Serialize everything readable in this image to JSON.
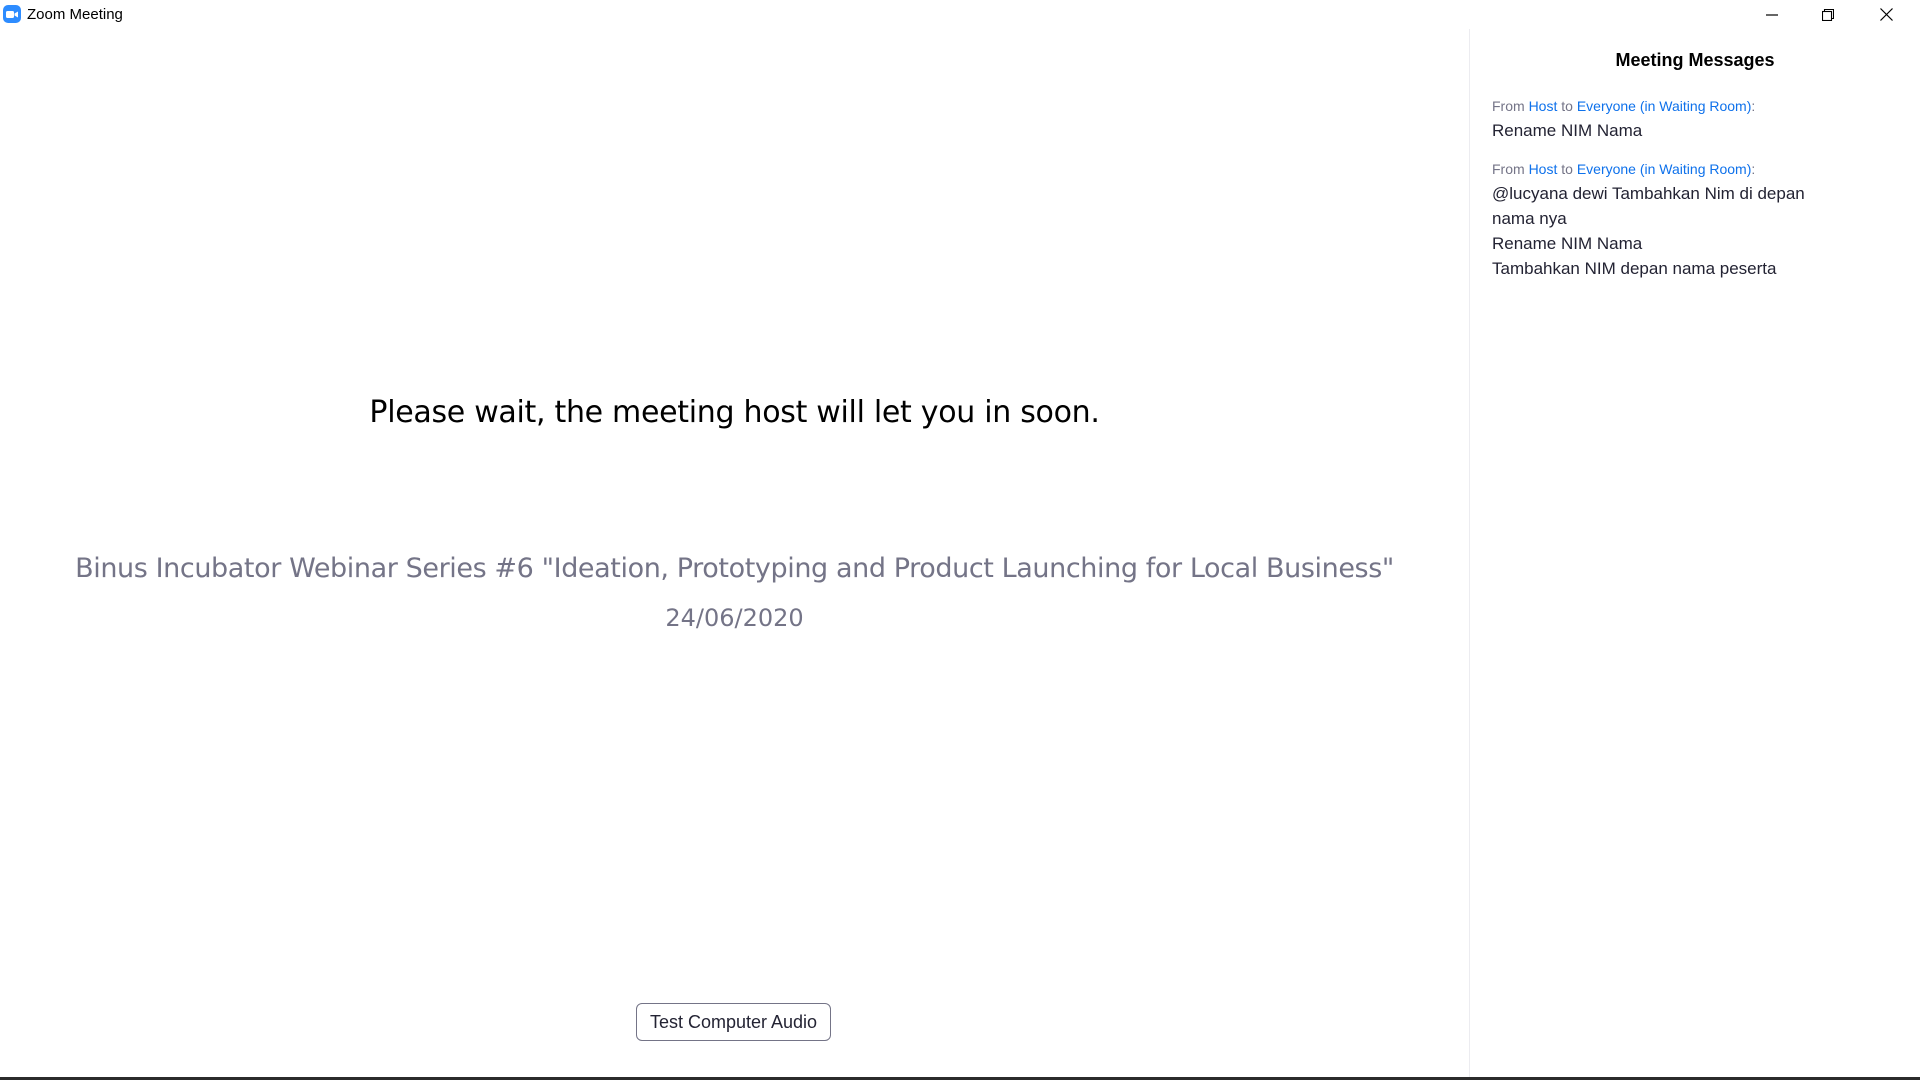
{
  "window": {
    "title": "Zoom Meeting",
    "app_icon": "zoom-camera-icon",
    "controls": [
      "minimize-icon",
      "restore-icon",
      "close-icon"
    ]
  },
  "main": {
    "wait_message": "Please wait, the meeting host will let you in soon.",
    "meeting_topic": "Binus Incubator Webinar Series #6 \"Ideation, Prototyping and Product Launching for Local Business\"",
    "meeting_date": "24/06/2020",
    "test_audio_label": "Test Computer Audio"
  },
  "panel": {
    "title": "Meeting Messages",
    "messages": [
      {
        "from_word": "From",
        "sender": "Host",
        "to_word": "to",
        "recipient": "Everyone (in Waiting Room)",
        "suffix": ":",
        "lines": [
          "Rename NIM Nama"
        ]
      },
      {
        "from_word": "From",
        "sender": "Host",
        "to_word": "to",
        "recipient": "Everyone (in Waiting Room)",
        "suffix": ":",
        "lines": [
          "@lucyana dewi Tambahkan Nim di depan",
          "nama nya",
          "Rename NIM Nama",
          "Tambahkan NIM depan nama peserta"
        ]
      }
    ]
  },
  "colors": {
    "accent": "#2D8CFF",
    "link": "#0E71EB",
    "muted_text": "#747487",
    "body_text": "#232333"
  }
}
